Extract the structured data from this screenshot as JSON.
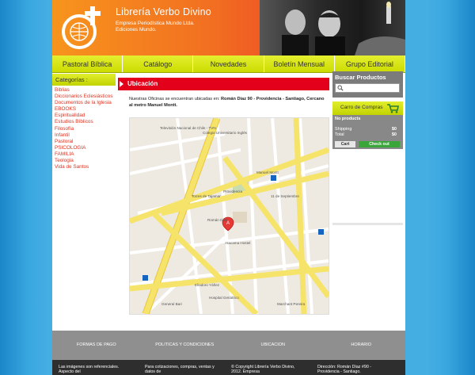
{
  "brand": {
    "title": "Librería Verbo Divino",
    "subtitle_line1": "Empresa Periodística Mundo Ltda.",
    "subtitle_line2": "Ediciones Mundo."
  },
  "nav": [
    {
      "label": "Pastoral Bíblica"
    },
    {
      "label": "Catálogo"
    },
    {
      "label": "Novedades"
    },
    {
      "label": "Boletín Mensual"
    },
    {
      "label": "Grupo Editorial"
    }
  ],
  "sidebar": {
    "heading": "Categorías :",
    "items": [
      "Biblias",
      "Diccionarios Eclesiásticos",
      "Documentos de la Iglesia",
      "EBOOKS",
      "Espiritualidad",
      "Estudios Bíblicos",
      "Filosofía",
      "Infantil",
      "Pastoral",
      "PSICOLOGIA",
      "FAMILIA",
      "Teologia",
      "Vida de Santos"
    ]
  },
  "main": {
    "section_title": "Ubicación",
    "intro_plain": "Nuestras Oficinas se encuentran ubicadas en: ",
    "intro_bold": "Román Díaz 90 - Providencia - Santiago, Cercano al metro Manuel Montt."
  },
  "map": {
    "labels": [
      {
        "text": "Televisión Nacional de Chile - TVN",
        "pos": "tl"
      },
      {
        "text": "Colegio Universitario Inglés",
        "pos": "tc"
      },
      {
        "text": "Manuel Montt",
        "pos": "c"
      },
      {
        "text": "Providencia",
        "pos": "c2"
      },
      {
        "text": "11 de Septiembre",
        "pos": "r"
      },
      {
        "text": "Torres de Tajamar",
        "pos": "l"
      },
      {
        "text": "Atacama Hostel",
        "pos": "c3"
      },
      {
        "text": "Román Díaz",
        "pos": "c4"
      },
      {
        "text": "Eliodoro Yáñez",
        "pos": "b"
      },
      {
        "text": "Hospital Geriátrico",
        "pos": "b2"
      },
      {
        "text": "General Bari",
        "pos": "b3"
      },
      {
        "text": "Marchant Pereira",
        "pos": "br"
      }
    ],
    "pin": "A"
  },
  "search": {
    "title": "Buscar Productos",
    "placeholder": ""
  },
  "cart": {
    "title": "Carro de Compras",
    "empty_text": "No products",
    "shipping_label": "Shipping",
    "shipping_value": "$0",
    "total_label": "Total",
    "total_value": "$0",
    "cart_button": "Cart",
    "checkout_button": "Check out"
  },
  "footer": {
    "nav": [
      "FORMAS DE PAGO",
      "POLITICAS Y CONDICIONES",
      "UBICACION",
      "HORARIO"
    ],
    "col1": "Las imágenes son referenciales. Aspecto del",
    "col2": "Para cotizaciones, compras, ventas y datos de",
    "col3": "© Copyright Librería Verbo Divino, 2012. Empresa",
    "col4": "Dirección: Román Díaz #90 - Providencia - Santiago."
  },
  "colors": {
    "accent_red": "#e2001a",
    "nav_green": "#c8d800",
    "header_orange": "#f26f21",
    "link_red": "#e0311f"
  }
}
